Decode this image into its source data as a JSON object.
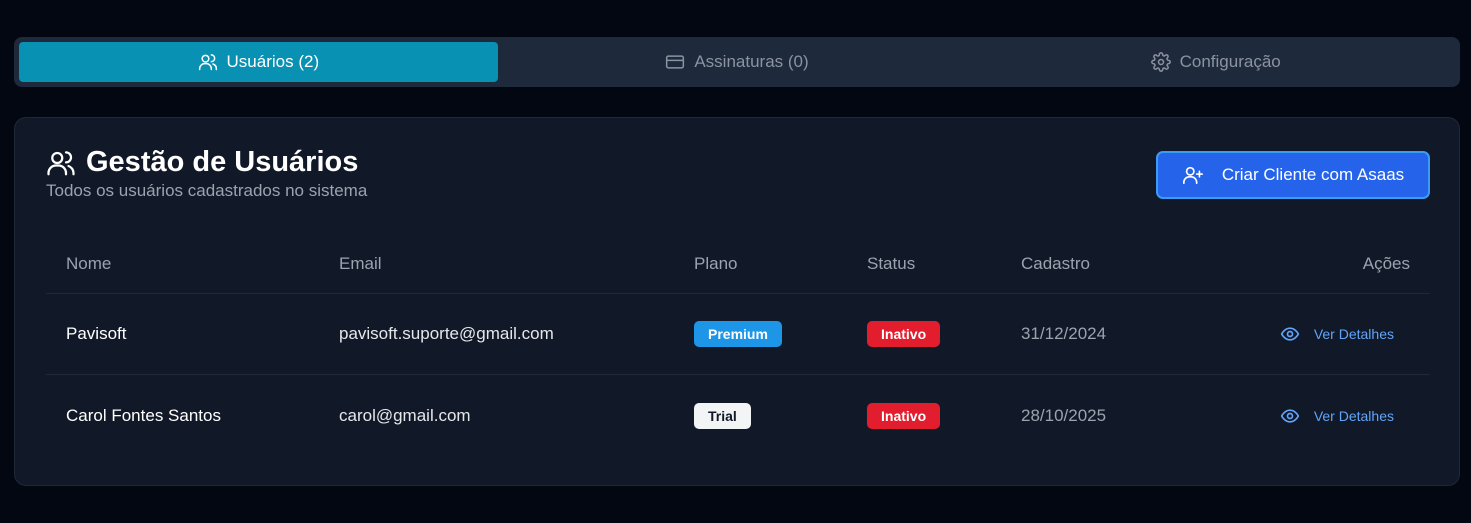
{
  "tabs": [
    {
      "label": "Usuários (2)",
      "icon": "users-icon",
      "active": true
    },
    {
      "label": "Assinaturas (0)",
      "icon": "credit-card-icon",
      "active": false
    },
    {
      "label": "Configuração",
      "icon": "gear-icon",
      "active": false
    }
  ],
  "card": {
    "title": "Gestão de Usuários",
    "title_icon": "users-icon",
    "subtitle": "Todos os usuários cadastrados no sistema",
    "create_button": "Criar Cliente com Asaas",
    "create_button_icon": "user-plus-icon"
  },
  "table": {
    "headers": {
      "name": "Nome",
      "email": "Email",
      "plan": "Plano",
      "status": "Status",
      "date": "Cadastro",
      "actions": "Ações"
    },
    "rows": [
      {
        "name": "Pavisoft",
        "email": "pavisoft.suporte@gmail.com",
        "plan": "Premium",
        "status": "Inativo",
        "date": "31/12/2024",
        "action": "Ver Detalhes"
      },
      {
        "name": "Carol Fontes Santos",
        "email": "carol@gmail.com",
        "plan": "Trial",
        "status": "Inativo",
        "date": "28/10/2025",
        "action": "Ver Detalhes"
      }
    ]
  },
  "colors": {
    "background": "#030712",
    "card": "#111827",
    "active_tab": "#0891b2",
    "primary_button": "#2563eb",
    "premium_badge": "#1d96e8",
    "inactive_badge": "#e11d2e",
    "link": "#60a5fa"
  }
}
